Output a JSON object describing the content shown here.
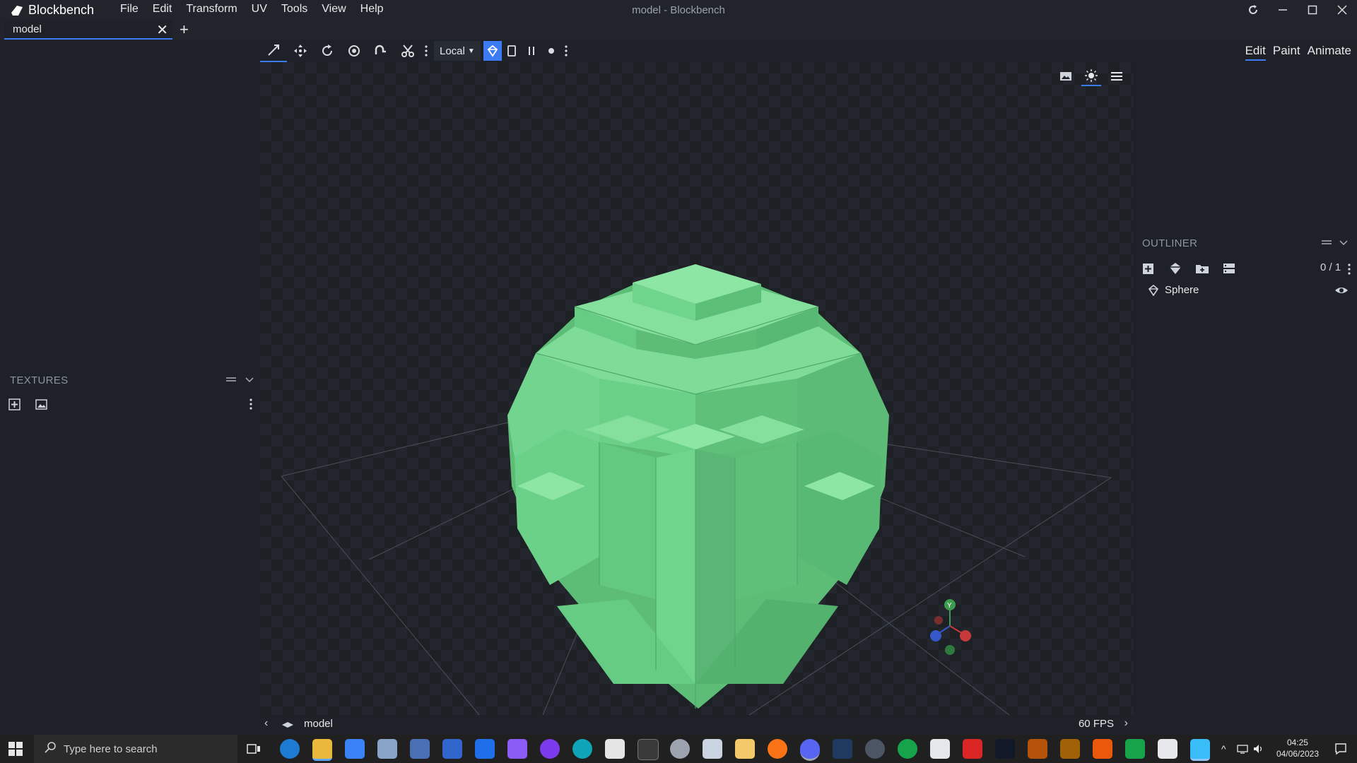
{
  "app": {
    "name": "Blockbench",
    "window_title": "model - Blockbench",
    "menu": [
      "File",
      "Edit",
      "Transform",
      "UV",
      "Tools",
      "View",
      "Help"
    ]
  },
  "tabs": {
    "active_label": "model"
  },
  "toolbar": {
    "space_select": "Local"
  },
  "modes": [
    "Edit",
    "Paint",
    "Animate"
  ],
  "textures_panel": {
    "title": "TEXTURES"
  },
  "outliner": {
    "title": "OUTLINER",
    "count": "0 / 1",
    "items": [
      {
        "label": "Sphere"
      }
    ]
  },
  "viewport": {
    "model_color": "#6fd48c",
    "axis_labels": {
      "y": "Y"
    }
  },
  "statusbar": {
    "model_name": "model",
    "fps": "60 FPS"
  },
  "taskbar": {
    "search_placeholder": "Type here to search",
    "time": "04:25",
    "date": "04/06/2023"
  },
  "colors": {
    "accent": "#3d7bf5",
    "background": "#1e2127"
  }
}
